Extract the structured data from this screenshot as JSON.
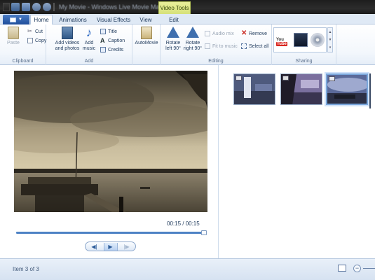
{
  "window": {
    "title": "My Movie - Windows Live Movie Maker"
  },
  "context_tab": {
    "title": "Video Tools"
  },
  "tabs": [
    {
      "label": "Home",
      "active": true
    },
    {
      "label": "Animations",
      "active": false
    },
    {
      "label": "Visual Effects",
      "active": false
    },
    {
      "label": "View",
      "active": false
    },
    {
      "label": "Edit",
      "active": false
    }
  ],
  "ribbon": {
    "clipboard": {
      "label": "Clipboard",
      "paste": "Paste",
      "cut": "Cut",
      "copy": "Copy"
    },
    "add": {
      "label": "Add",
      "add_videos_line1": "Add videos",
      "add_videos_line2": "and photos",
      "add_music_line1": "Add",
      "add_music_line2": "music",
      "title": "Title",
      "caption": "Caption",
      "credits": "Credits"
    },
    "automovie": {
      "label": "AutoMovie"
    },
    "editing": {
      "label": "Editing",
      "rotate_left_line1": "Rotate",
      "rotate_left_line2": "left 90°",
      "rotate_right_line1": "Rotate",
      "rotate_right_line2": "right 90°",
      "audio_mix": "Audio mix",
      "fit_to_music": "Fit to music",
      "remove": "Remove",
      "select_all": "Select all"
    },
    "sharing": {
      "label": "Sharing",
      "youtube_text": "You",
      "youtube_badge": "Tube"
    }
  },
  "player": {
    "timecode": "00:15 / 00:15",
    "progress": 1.0
  },
  "storyboard": {
    "item_count": 3,
    "selected_index": 2
  },
  "status": {
    "text": "Item 3 of 3"
  },
  "colors": {
    "accent": "#4d82c4",
    "context_tab": "#d6e17a",
    "remove_red": "#c8261f"
  }
}
